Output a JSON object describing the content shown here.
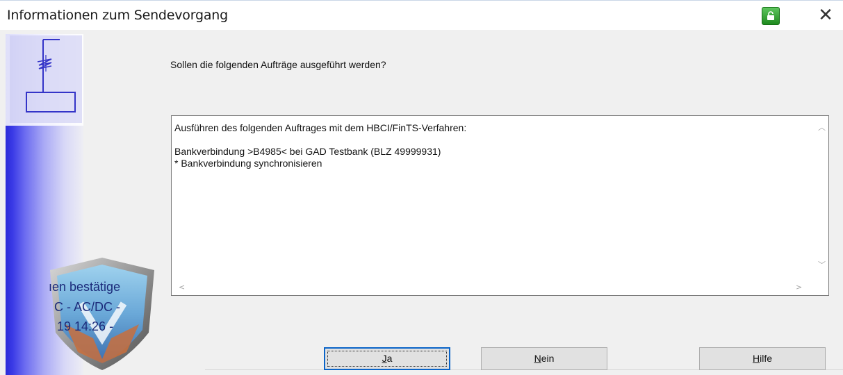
{
  "window": {
    "title": "Informationen zum Sendevorgang",
    "close_glyph": "✕"
  },
  "icons": {
    "lock": "padlock-icon",
    "close": "close-icon",
    "doc": "document-sign-icon",
    "shield": "shield-logo"
  },
  "shield_text": {
    "line1": "ıen bestätige",
    "line2": "C - AC/DC - ",
    "line3": "19  14:26 - "
  },
  "question": "Sollen die folgenden Aufträge ausgeführt werden?",
  "details": {
    "line1": "Ausführen des folgenden Auftrages mit dem HBCI/FinTS-Verfahren:",
    "line2": "",
    "line3": "Bankverbindung >B4985< bei GAD Testbank (BLZ 49999931)",
    "line4": "* Bankverbindung synchronisieren"
  },
  "buttons": {
    "yes": {
      "mnemonic": "J",
      "rest": "a"
    },
    "no": {
      "mnemonic": "N",
      "rest": "ein"
    },
    "help": {
      "mnemonic": "H",
      "rest": "ilfe"
    }
  },
  "colors": {
    "sidebar_blue": "#2b2bd8",
    "lock_green": "#2fa52f",
    "default_button_border": "#0a64c8"
  }
}
